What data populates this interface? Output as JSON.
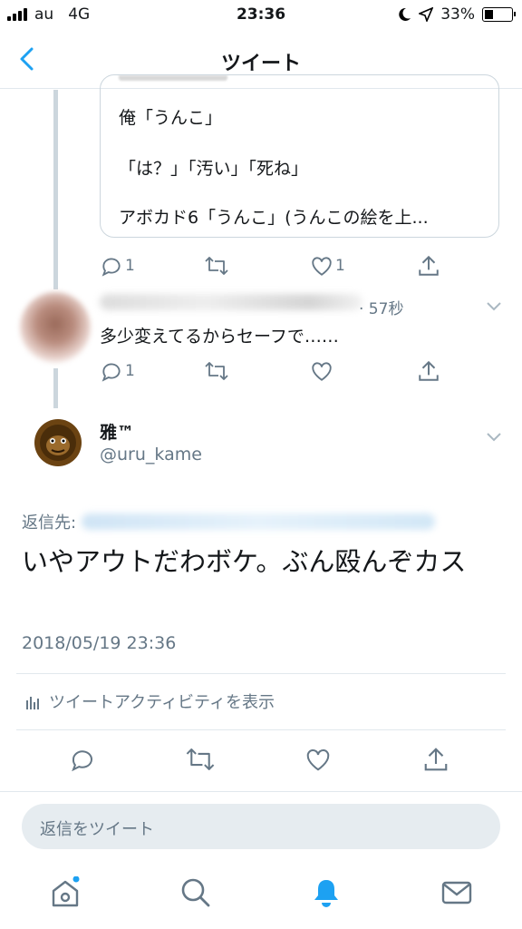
{
  "status_bar": {
    "carrier": "au",
    "network": "4G",
    "time": "23:36",
    "battery": "33%",
    "battery_level": 0.33
  },
  "nav": {
    "title": "ツイート",
    "back_icon": "chevron-left-icon"
  },
  "quoted_tweet": {
    "lines": [
      "俺「うんこ」",
      "「は？」「汚い」「死ね」",
      "アボカド6「うんこ」(うんこの絵を上..."
    ],
    "actions": {
      "reply_count": "1",
      "like_count": "1"
    }
  },
  "reply": {
    "time": "· 57秒",
    "text": "多少変えてるからセーフで……",
    "actions": {
      "reply_count": "1"
    }
  },
  "main_tweet": {
    "name": "雅™",
    "handle": "@uru_kame",
    "reply_to_label": "返信先:",
    "text": "いやアウトだわボケ。ぶん殴んぞカス",
    "date": "2018/05/19 23:36",
    "activity_label": "ツイートアクティビティを表示"
  },
  "compose": {
    "placeholder": "返信をツイート"
  },
  "tabbar": {
    "items": [
      "home-icon",
      "search-icon",
      "notifications-icon",
      "messages-icon"
    ],
    "active": "notifications-icon"
  },
  "colors": {
    "accent": "#1da1f2",
    "secondary_text": "#657786",
    "border": "#e1e8ed",
    "compose_bg": "#e6ecf0"
  }
}
